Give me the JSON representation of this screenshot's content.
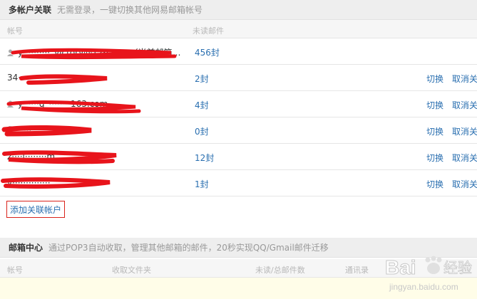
{
  "multi_account": {
    "title": "多帐户关联",
    "description": "无需登录，一键切换其他网易邮箱帐号",
    "columns": {
      "account": "帐号",
      "unread": "未读邮件"
    },
    "rows": [
      {
        "account": "y··········_victory@126.com（当前邮箱…",
        "unread": "456封",
        "switch": "",
        "cancel": ""
      },
      {
        "account": "34·····················",
        "unread": "2封",
        "switch": "切换",
        "cancel": "取消关"
      },
      {
        "account": "y······g_········163.com",
        "unread": "4封",
        "switch": "切换",
        "cancel": "取消关"
      },
      {
        "account": "fl·······",
        "unread": "0封",
        "switch": "切换",
        "cancel": "取消关"
      },
      {
        "account": "z····l········m",
        "unread": "12封",
        "switch": "切换",
        "cancel": "取消关"
      },
      {
        "account": "y··············",
        "unread": "1封",
        "switch": "切换",
        "cancel": "取消关"
      }
    ],
    "add_link": "添加关联帐户"
  },
  "mailbox_center": {
    "title": "邮箱中心",
    "description": "通过POP3自动收取，管理其他邮箱的邮件，20秒实现QQ/Gmail邮件迁移",
    "columns": {
      "account": "帐号",
      "folder": "收取文件夹",
      "count": "未读/总邮件数",
      "status": "通讯录"
    }
  },
  "watermark": {
    "brand": "Bai",
    "site": "经验",
    "url": "jingyan.baidu.com"
  },
  "colors": {
    "link": "#2a6fb0",
    "redact": "#e8141b",
    "highlight_border": "#d9231b",
    "header_bg": "#eeeeee"
  }
}
